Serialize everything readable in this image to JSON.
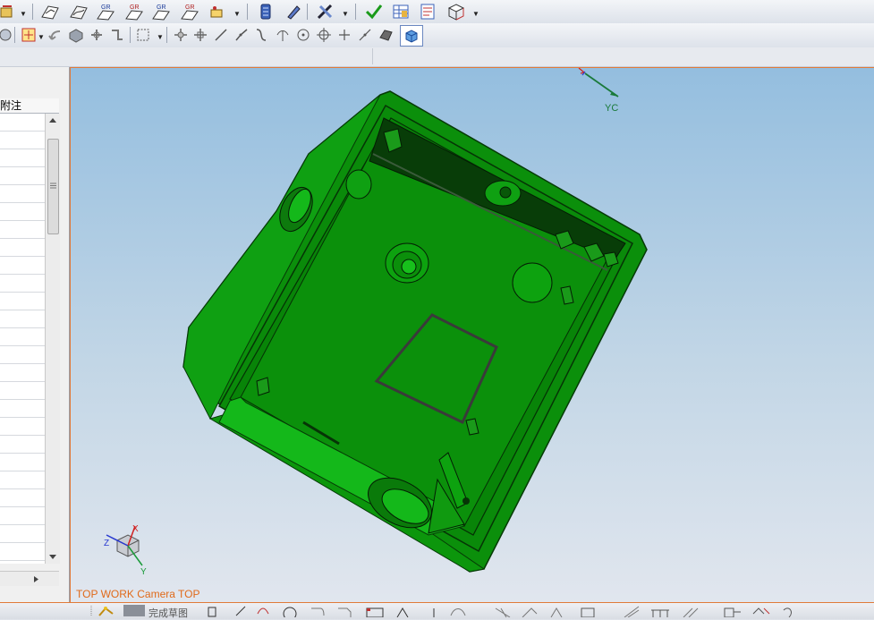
{
  "panel": {
    "header_label": "附注",
    "row_count": 25
  },
  "viewport": {
    "camera_label": "TOP WORK Camera TOP",
    "axis_top_label": "YC",
    "triad": {
      "x_label": "X",
      "y_label": "Y",
      "z_label": "Z"
    }
  },
  "status_bar": {
    "label": "完成草图"
  },
  "colors": {
    "model_green": "#0a9a0a",
    "model_dark": "#063e06",
    "accent_orange": "#e07a3a"
  },
  "icons": {
    "toolbar1": [
      "sheet-metal-icon",
      "surface-icon",
      "gr-surface-icon",
      "gr-surface-2-icon",
      "gr-surface-3-icon",
      "gr-surface-4-icon",
      "attribute-icon",
      "layer-icon",
      "pen-icon",
      "tools-icon",
      "check-icon",
      "table-icon",
      "report-icon",
      "view-icon"
    ],
    "toolbar2": [
      "snap-icon",
      "face-select-icon",
      "arrow-icon",
      "solid-icon",
      "wire-icon",
      "route-icon",
      "box-select-icon",
      "move-icon",
      "pan-icon",
      "line-icon",
      "curve-icon",
      "arc-icon",
      "point-icon",
      "circle-icon",
      "crosshair-icon",
      "plus-icon",
      "slash-icon",
      "shade-icon",
      "cube-view-icon"
    ]
  }
}
